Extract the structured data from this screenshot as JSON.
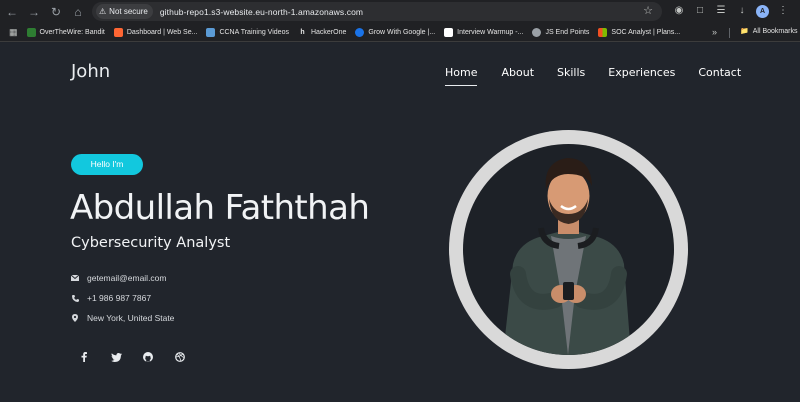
{
  "browser": {
    "security_label": "Not secure",
    "url": "github-repo1.s3-website.eu-north-1.amazonaws.com",
    "profile_initial": "A",
    "bookmarks": [
      {
        "label": "OverTheWire: Bandit",
        "icon": "overthewire-icon",
        "color": "#4caf50"
      },
      {
        "label": "Dashboard | Web Se...",
        "icon": "portswigger-icon",
        "color": "#ff6633"
      },
      {
        "label": "CCNA Training Videos",
        "icon": "image-icon",
        "color": "#5b9bd5"
      },
      {
        "label": "HackerOne",
        "icon": "hackerone-icon",
        "color": "#333333"
      },
      {
        "label": "Grow With Google |...",
        "icon": "google-icon",
        "color": "#1a73e8"
      },
      {
        "label": "Interview Warmup -...",
        "icon": "doc-icon",
        "color": "#ffffff"
      },
      {
        "label": "JS End Points",
        "icon": "globe-icon",
        "color": "#9aa0a6"
      },
      {
        "label": "SOC Analyst | Plans...",
        "icon": "microsoft-icon",
        "color": "#f25022"
      }
    ],
    "all_bookmarks_label": "All Bookmarks"
  },
  "site": {
    "logo": "John",
    "nav": [
      "Home",
      "About",
      "Skills",
      "Experiences",
      "Contact"
    ]
  },
  "hero": {
    "badge": "Hello I'm",
    "name": "Abdullah Faththah",
    "role": "Cybersecurity Analyst",
    "email": "getemail@email.com",
    "phone": "+1 986 987 7867",
    "location": "New York, United State",
    "socials": [
      "facebook-icon",
      "twitter-icon",
      "github-icon",
      "dribbble-icon"
    ],
    "accent": "#12c8de"
  }
}
